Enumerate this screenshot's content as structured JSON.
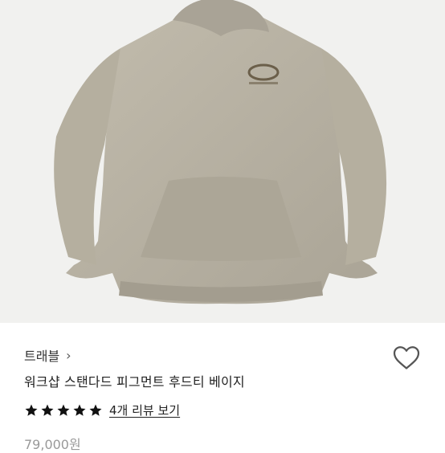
{
  "product": {
    "brand": "트래블",
    "brand_chevron": "›",
    "title": "워크샵 스탠다드 피그먼트 후드티 베이지",
    "rating_stars": 5,
    "review_text": "4개 리뷰 보기",
    "price": "79,000원"
  },
  "icons": {
    "wishlist": "heart-outline-icon",
    "star": "star-icon",
    "chevron": "chevron-right-icon"
  },
  "colors": {
    "hoodie": "#b8b2a4",
    "hoodie_shadow": "#a29c8e",
    "background": "#f1f1ef",
    "star": "#111111"
  }
}
